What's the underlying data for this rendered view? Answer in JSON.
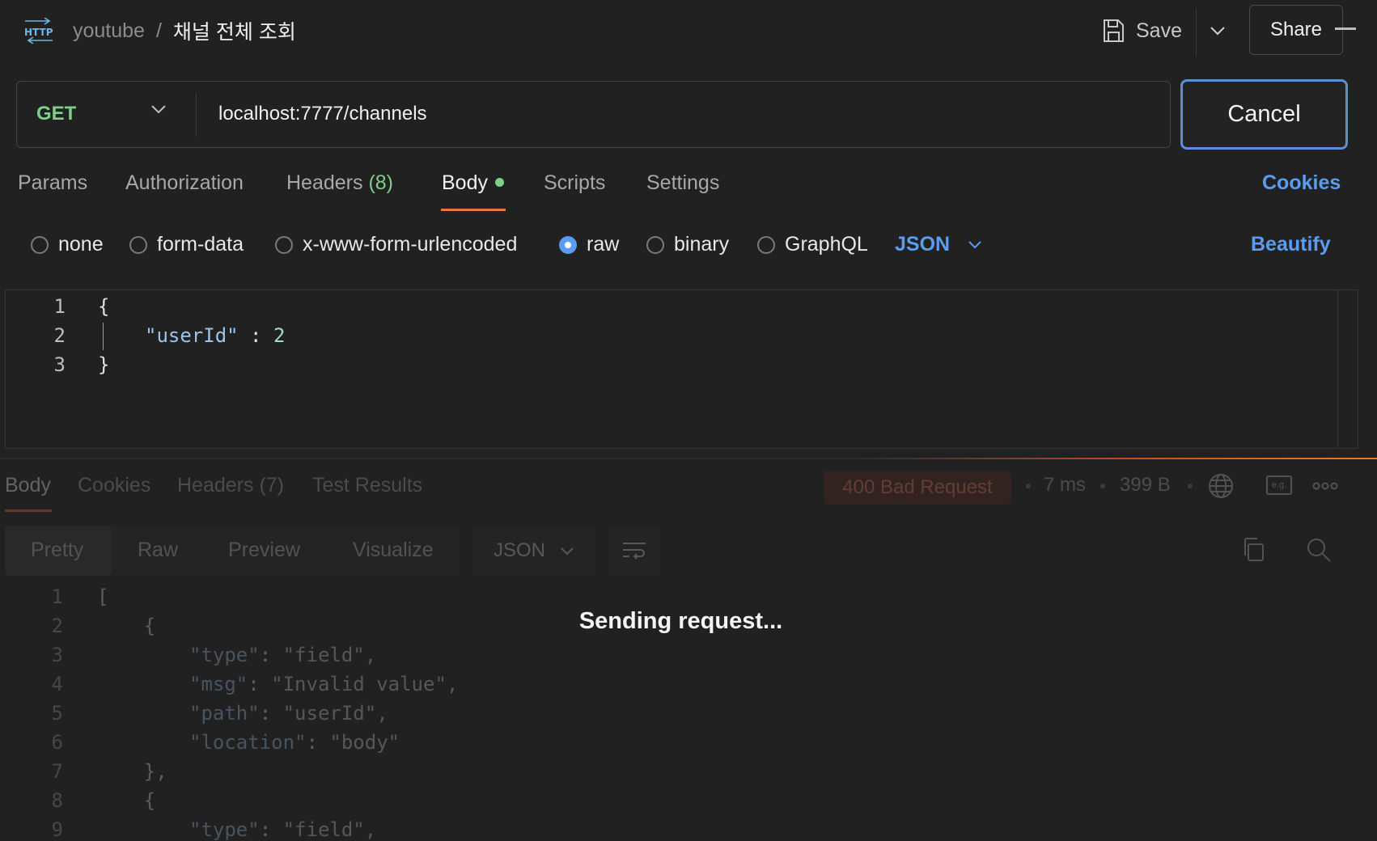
{
  "header": {
    "collection": "youtube",
    "separator": "/",
    "request_name": "채널 전체 조회",
    "save_label": "Save",
    "share_label": "Share"
  },
  "request": {
    "method": "GET",
    "url": "localhost:7777/channels",
    "cancel_label": "Cancel",
    "tabs": [
      {
        "label": "Params"
      },
      {
        "label": "Authorization"
      },
      {
        "label": "Headers",
        "count": "(8)"
      },
      {
        "label": "Body"
      },
      {
        "label": "Scripts"
      },
      {
        "label": "Settings"
      }
    ],
    "active_tab": "Body",
    "cookies_label": "Cookies",
    "body_types": [
      "none",
      "form-data",
      "x-www-form-urlencoded",
      "raw",
      "binary",
      "GraphQL"
    ],
    "selected_body_type": "raw",
    "raw_format": "JSON",
    "beautify_label": "Beautify",
    "body_lines": [
      {
        "num": "1",
        "text": "{"
      },
      {
        "num": "2",
        "key": "\"userId\"",
        "sep": " : ",
        "value": "2"
      },
      {
        "num": "3",
        "text": "}"
      }
    ]
  },
  "response": {
    "tabs": [
      {
        "label": "Body"
      },
      {
        "label": "Cookies"
      },
      {
        "label": "Headers (7)"
      },
      {
        "label": "Test Results"
      }
    ],
    "status": "400 Bad Request",
    "time": "7 ms",
    "size": "399 B",
    "eg_label": "e.g.",
    "view_modes": [
      "Pretty",
      "Raw",
      "Preview",
      "Visualize"
    ],
    "format": "JSON",
    "lines": [
      {
        "num": "1",
        "text": "["
      },
      {
        "num": "2",
        "text": "    {"
      },
      {
        "num": "3",
        "key": "\"type\"",
        "value": "\"field\","
      },
      {
        "num": "4",
        "key": "\"msg\"",
        "value": "\"Invalid value\","
      },
      {
        "num": "5",
        "key": "\"path\"",
        "value": "\"userId\","
      },
      {
        "num": "6",
        "key": "\"location\"",
        "value": "\"body\""
      },
      {
        "num": "7",
        "text": "    },"
      },
      {
        "num": "8",
        "text": "    {"
      },
      {
        "num": "9",
        "key": "\"type\"",
        "value": "\"field\","
      }
    ],
    "loading_text": "Sending request..."
  },
  "colors": {
    "accent": "#5a9cf0",
    "method_get": "#7fce8b",
    "tab_underline": "#e8773b",
    "error": "#f07a62"
  }
}
